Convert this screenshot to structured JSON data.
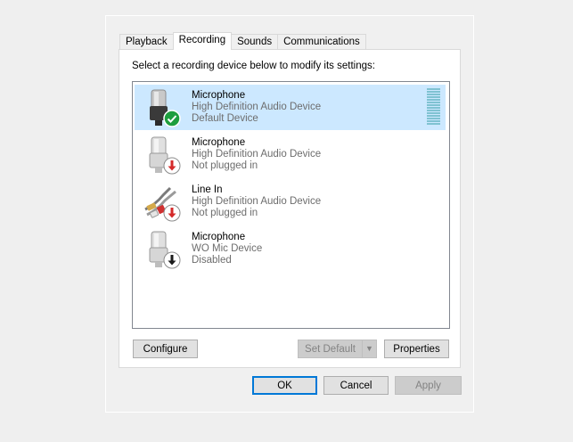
{
  "tabs": [
    {
      "label": "Playback",
      "active": false
    },
    {
      "label": "Recording",
      "active": true
    },
    {
      "label": "Sounds",
      "active": false
    },
    {
      "label": "Communications",
      "active": false
    }
  ],
  "instructions": "Select a recording device below to modify its settings:",
  "devices": [
    {
      "name": "Microphone",
      "device": "High Definition Audio Device",
      "status": "Default Device",
      "icon": "microphone-icon",
      "badge": "green-check-badge",
      "selected": true
    },
    {
      "name": "Microphone",
      "device": "High Definition Audio Device",
      "status": "Not plugged in",
      "icon": "microphone-icon",
      "badge": "red-down-arrow-badge",
      "selected": false
    },
    {
      "name": "Line In",
      "device": "High Definition Audio Device",
      "status": "Not plugged in",
      "icon": "line-in-cable-icon",
      "badge": "red-down-arrow-badge",
      "selected": false
    },
    {
      "name": "Microphone",
      "device": "WO Mic Device",
      "status": "Disabled",
      "icon": "microphone-icon",
      "badge": "black-down-arrow-badge",
      "selected": false
    }
  ],
  "buttons": {
    "configure": "Configure",
    "set_default": "Set Default",
    "properties": "Properties",
    "ok": "OK",
    "cancel": "Cancel",
    "apply": "Apply"
  },
  "colors": {
    "selection": "#cce8ff",
    "default_button_border": "#0078d7",
    "badge_green": "#1e9e3e",
    "badge_red": "#d42a2a"
  }
}
